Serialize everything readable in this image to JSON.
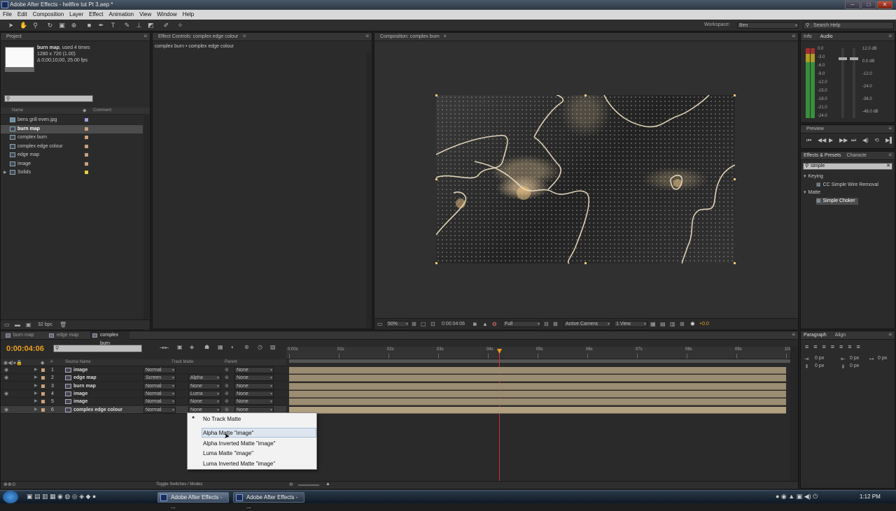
{
  "window": {
    "title": "Adobe After Effects - hellfire tut Pt 3.aep *"
  },
  "menu": [
    "File",
    "Edit",
    "Composition",
    "Layer",
    "Effect",
    "Animation",
    "View",
    "Window",
    "Help"
  ],
  "workspace": {
    "label": "Workspace:",
    "value": "Ben"
  },
  "search_help": "Search Help",
  "project": {
    "tab": "Project",
    "item_name": "burn map",
    "used": ", used 4 times",
    "dims": "1280 x 720 (1.00)",
    "duration": "Δ 0;00;10;00, 25.00 fps",
    "col_name": "Name",
    "col_comment": "Comment",
    "items": [
      {
        "label": "bens grill even.jpg",
        "color": "#a0a0d8"
      },
      {
        "label": "burn map",
        "color": "#c8a080"
      },
      {
        "label": "complex burn",
        "color": "#c8a080"
      },
      {
        "label": "complex edge colour",
        "color": "#c8a080"
      },
      {
        "label": "edge map",
        "color": "#c8a080"
      },
      {
        "label": "image",
        "color": "#c8a080"
      },
      {
        "label": "Solids",
        "color": "#e0d040"
      }
    ],
    "bpc": "32 bpc"
  },
  "effect_controls": {
    "tab": "Effect Controls: complex edge colour",
    "subtitle": "complex burn • complex edge colour"
  },
  "composition": {
    "tab": "Composition: complex burn",
    "zoom": "50%",
    "timecode": "0:00:04:06",
    "resolution": "Full",
    "camera": "Active Camera",
    "view": "1 View",
    "exposure": "+0.0"
  },
  "info_audio": {
    "tab_info": "Info",
    "tab_audio": "Audio",
    "left_scale": [
      "0.0",
      "-3.0",
      "-6.0",
      "-9.0",
      "-12.0",
      "-15.0",
      "-18.0",
      "-21.0",
      "-24.0"
    ],
    "right_scale": [
      "12.0 dB",
      "0.0 dB",
      "-12.0",
      "-24.0",
      "-36.0",
      "-48.0 dB"
    ]
  },
  "preview": {
    "tab": "Preview"
  },
  "effects_presets": {
    "tab": "Effects & Presets",
    "tab2": "Characte",
    "search": "simple",
    "tree": [
      {
        "label": "Keying",
        "level": 0
      },
      {
        "label": "CC Simple Wire Removal",
        "level": 1
      },
      {
        "label": "Matte",
        "level": 0
      },
      {
        "label": "Simple Choker",
        "level": 1
      }
    ]
  },
  "paragraph": {
    "tab": "Paragraph",
    "tab2": "Align",
    "fields": [
      "0 px",
      "0 px",
      "0 px",
      "0 px",
      "0 px"
    ]
  },
  "timeline": {
    "tabs": [
      "burn map",
      "edge map",
      "complex burn"
    ],
    "timecode": "0:00:04:06",
    "col_num": "#",
    "col_source": "Source Name",
    "col_trackmatte": "Track Matte",
    "col_parent": "Parent",
    "ruler": [
      "0:00s",
      "01s",
      "02s",
      "03s",
      "04s",
      "05s",
      "06s",
      "07s",
      "08s",
      "09s",
      "10s"
    ],
    "layers": [
      {
        "num": "1",
        "name": "image",
        "mode": "Normal",
        "matte": "",
        "parent": "None"
      },
      {
        "num": "2",
        "name": "edge map",
        "mode": "Screen",
        "matte": "Alpha",
        "parent": "None"
      },
      {
        "num": "3",
        "name": "burn map",
        "mode": "Normal",
        "matte": "None",
        "parent": "None"
      },
      {
        "num": "4",
        "name": "image",
        "mode": "Normal",
        "matte": "Luma",
        "parent": "None"
      },
      {
        "num": "5",
        "name": "image",
        "mode": "Normal",
        "matte": "None",
        "parent": "None"
      },
      {
        "num": "6",
        "name": "complex edge colour",
        "mode": "Normal",
        "matte": "None",
        "parent": "None"
      }
    ],
    "footer": "Toggle Switches / Modes"
  },
  "track_matte_menu": {
    "items": [
      "No Track Matte",
      "Alpha Matte \"image\"",
      "Alpha Inverted Matte \"image\"",
      "Luma Matte \"image\"",
      "Luma Inverted Matte \"image\""
    ]
  },
  "taskbar": {
    "buttons": [
      "Adobe After Effects - ...",
      "Adobe After Effects - ..."
    ],
    "time": "1:12 PM"
  },
  "colors": {
    "accent": "#e8a020",
    "playhead": "#d03030",
    "layer_bar": "#9b8d72"
  }
}
